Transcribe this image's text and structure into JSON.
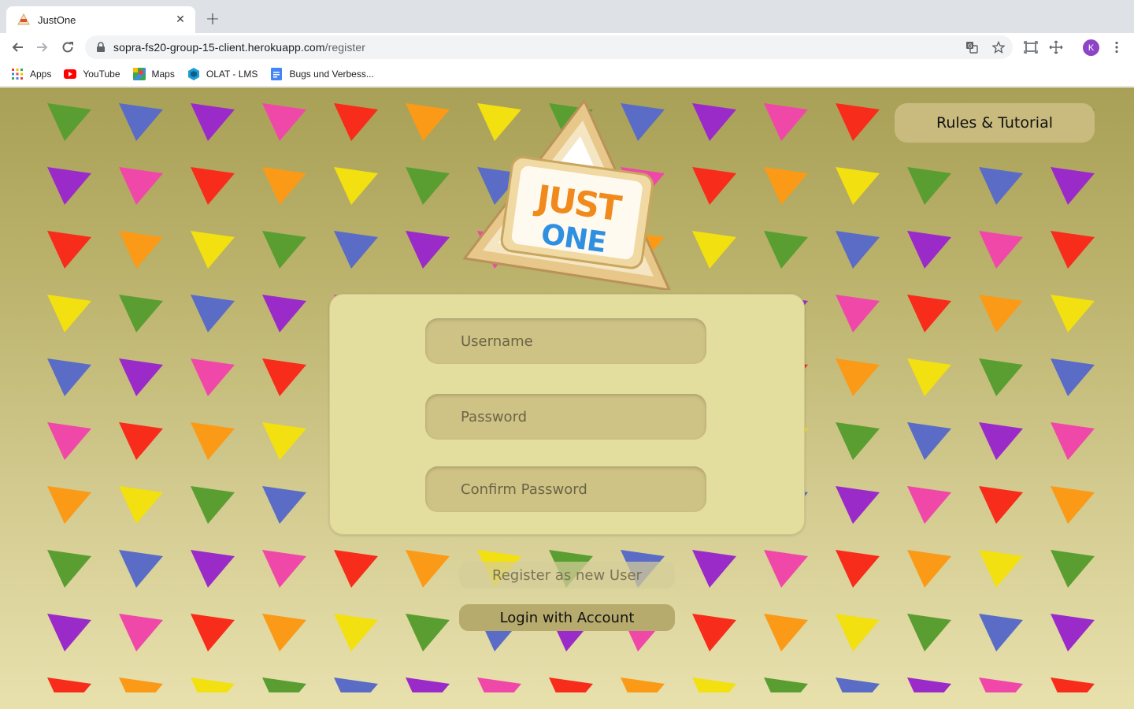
{
  "browser": {
    "tab_title": "JustOne",
    "url_host": "sopra-fs20-group-15-client.herokuapp.com",
    "url_path": "/register",
    "profile_initial": "K",
    "bookmarks": [
      {
        "label": "Apps",
        "icon": "apps-grid-icon"
      },
      {
        "label": "YouTube",
        "icon": "youtube-icon"
      },
      {
        "label": "Maps",
        "icon": "maps-icon"
      },
      {
        "label": "OLAT - LMS",
        "icon": "olat-icon"
      },
      {
        "label": "Bugs und Verbess...",
        "icon": "docs-icon"
      }
    ]
  },
  "page": {
    "rules_button": "Rules & Tutorial",
    "logo": {
      "line1": "JUST",
      "line2": "ONE"
    },
    "form": {
      "username_placeholder": "Username",
      "password_placeholder": "Password",
      "confirm_placeholder": "Confirm Password"
    },
    "register_button": "Register as new User",
    "login_button": "Login with Account"
  },
  "colors": {
    "triangles": [
      "#5a9e32",
      "#5a6cc6",
      "#9b2bc9",
      "#f048a8",
      "#f72c1a",
      "#fb9a17",
      "#f2e010"
    ]
  }
}
